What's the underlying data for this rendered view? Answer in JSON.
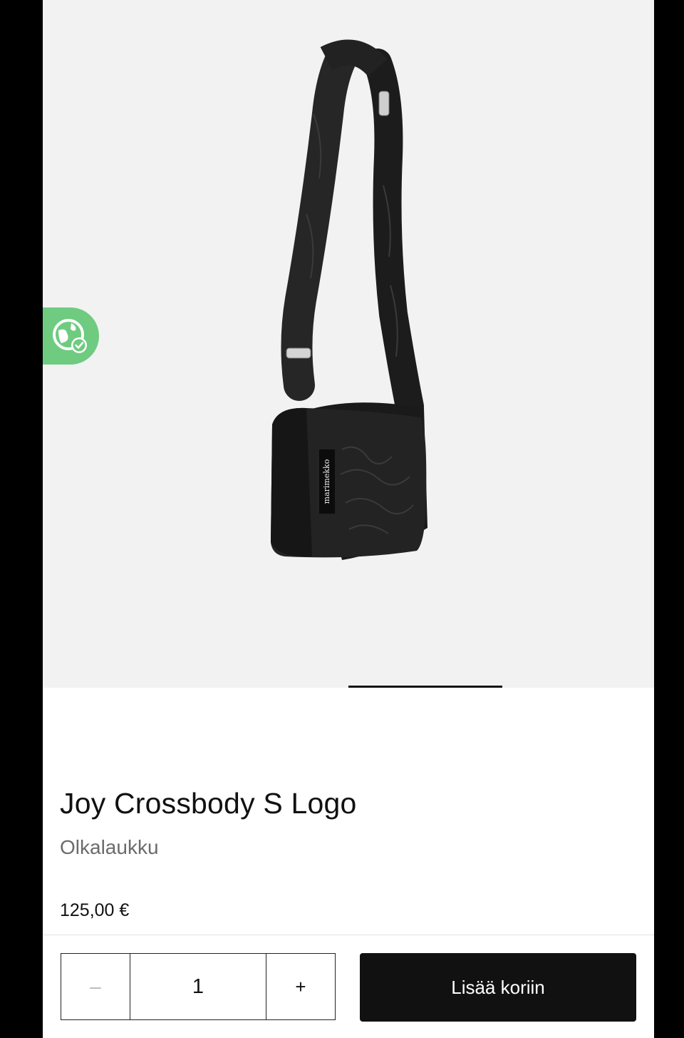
{
  "product": {
    "title": "Joy Crossbody S Logo",
    "category": "Olkalaukku",
    "price": "125,00 €",
    "brand_label": "marimekko"
  },
  "gallery": {
    "image_subject": "black quilted crossbody bag with shoulder strap",
    "badge_icon": "globe-check-icon"
  },
  "purchase": {
    "decrement_label": "–",
    "quantity": "1",
    "increment_label": "+",
    "add_to_cart_label": "Lisää koriin"
  },
  "colors": {
    "badge": "#6ecb80",
    "button": "#111111",
    "background": "#f2f2f2"
  }
}
